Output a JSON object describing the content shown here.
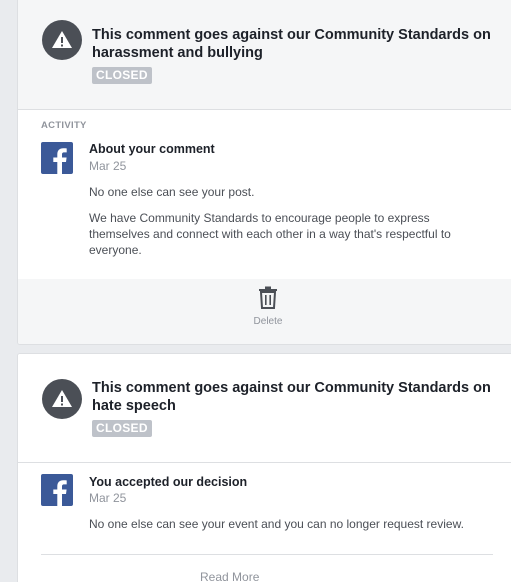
{
  "cards": [
    {
      "title": "This comment goes against our Community Standards on harassment and bullying",
      "status": "CLOSED",
      "activity_label": "ACTIVITY",
      "activity": {
        "title": "About your comment",
        "date": "Mar 25",
        "paragraphs": [
          "No one else can see your post.",
          "We have Community Standards to encourage people to express themselves and connect with each other in a way that's respectful to everyone."
        ]
      },
      "action_label": "Delete"
    },
    {
      "title": "This comment goes against our Community Standards on hate speech",
      "status": "CLOSED",
      "activity": {
        "title": "You accepted our decision",
        "date": "Mar 25",
        "paragraphs": [
          "No one else can see your event and you can no longer request review."
        ]
      },
      "read_more_label": "Read More"
    }
  ],
  "icons": {
    "warning": "warning-icon",
    "facebook": "facebook-logo-icon",
    "trash": "trash-icon"
  },
  "colors": {
    "background": "#e9ebee",
    "warning_circle": "#4b4f56",
    "badge": "#bec2c9",
    "facebook_blue": "#3b5998"
  }
}
